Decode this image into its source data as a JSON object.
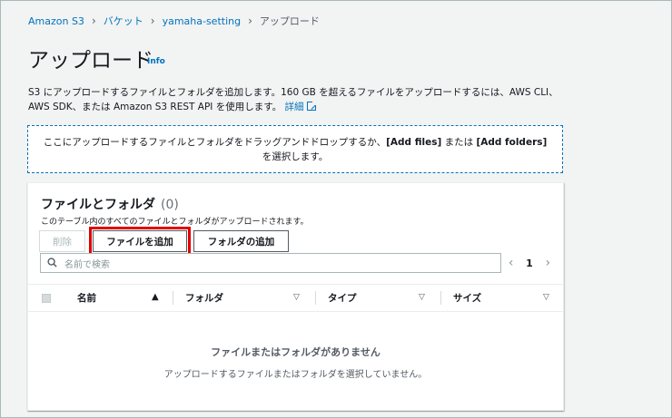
{
  "breadcrumb": {
    "items": [
      "Amazon S3",
      "バケット",
      "yamaha-setting"
    ],
    "current": "アップロード"
  },
  "page": {
    "title": "アップロード",
    "info": "Info",
    "description": "S3 にアップロードするファイルとフォルダを追加します。160 GB を超えるファイルをアップロードするには、AWS CLI、AWS SDK、または Amazon S3 REST API を使用します。",
    "details_link": "詳細"
  },
  "dropzone": {
    "text_before": "ここにアップロードするファイルとフォルダをドラッグアンドドロップするか、",
    "add_files": "[Add files]",
    "text_middle": " または ",
    "add_folders": "[Add folders]",
    "text_after": " を選択します。"
  },
  "panel": {
    "title": "ファイルとフォルダ",
    "count": "(0)",
    "subtitle": "このテーブル内のすべてのファイルとフォルダがアップロードされます。",
    "delete_label": "削除",
    "add_file_label": "ファイルを追加",
    "add_folder_label": "フォルダの追加",
    "search_placeholder": "名前で検索",
    "page_number": "1",
    "columns": [
      "名前",
      "フォルダ",
      "タイプ",
      "サイズ"
    ],
    "empty_title": "ファイルまたはフォルダがありません",
    "empty_subtitle": "アップロードするファイルまたはフォルダを選択していません。"
  },
  "colors": {
    "link": "#0073bb",
    "highlight": "#e00000",
    "background": "#f2f3f3"
  }
}
